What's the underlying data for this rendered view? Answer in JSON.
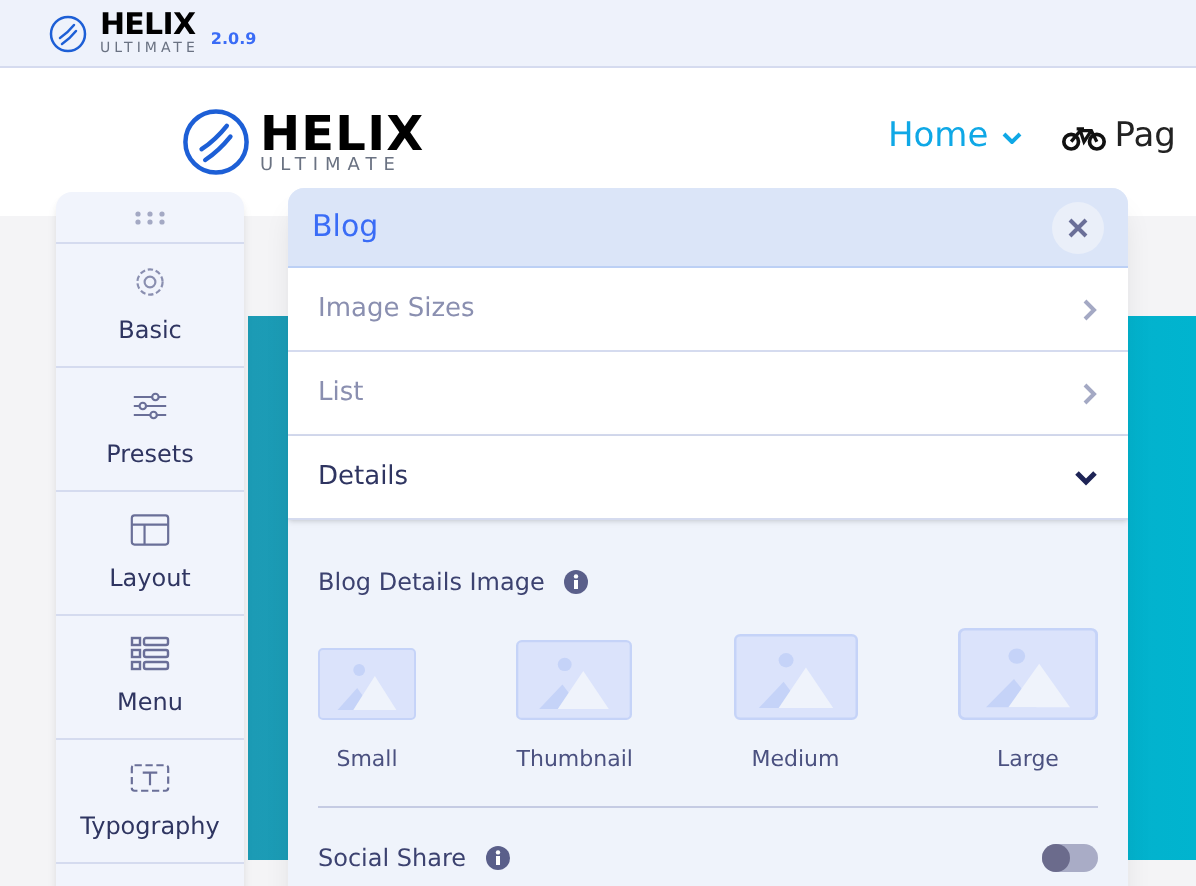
{
  "admin_bar": {
    "logo_title": "HELIX",
    "logo_subtitle": "ULTIMATE",
    "version": "2.0.9"
  },
  "site_header": {
    "logo_title": "HELIX",
    "logo_subtitle": "ULTIMATE",
    "nav": [
      {
        "label": "Home",
        "kind": "dropdown",
        "selected": true
      },
      {
        "label": "Pag",
        "kind": "icon",
        "selected": false
      }
    ]
  },
  "sidebar": {
    "items": [
      {
        "label": "Basic",
        "kind": "gear"
      },
      {
        "label": "Presets",
        "kind": "sliders"
      },
      {
        "label": "Layout",
        "kind": "layout"
      },
      {
        "label": "Menu",
        "kind": "menu"
      },
      {
        "label": "Typography",
        "kind": "type"
      }
    ]
  },
  "panel": {
    "title": "Blog",
    "sections": [
      {
        "label": "Image Sizes",
        "expanded": false
      },
      {
        "label": "List",
        "expanded": false
      },
      {
        "label": "Details",
        "expanded": true
      }
    ],
    "details": {
      "image_label": "Blog Details Image",
      "image_options": [
        {
          "label": "Small",
          "kind": "small"
        },
        {
          "label": "Thumbnail",
          "kind": "thumbnail"
        },
        {
          "label": "Medium",
          "kind": "medium"
        },
        {
          "label": "Large",
          "kind": "large"
        }
      ],
      "toggles": [
        {
          "label": "Social Share",
          "on": false
        }
      ]
    }
  }
}
